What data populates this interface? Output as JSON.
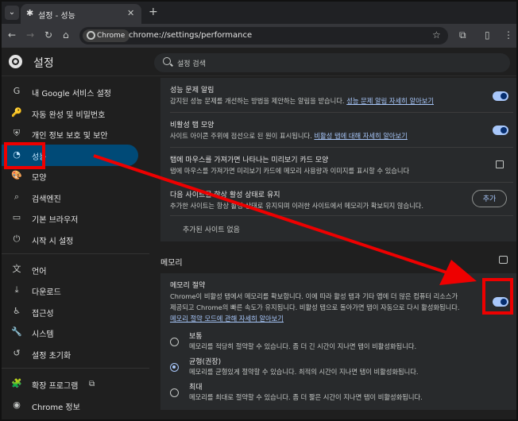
{
  "tabstrip": {
    "menu_icon": "chevron-down-icon",
    "tab_title": "설정 - 성능",
    "tab_icon": "gear-icon",
    "close_icon": "close-icon",
    "new_tab_icon": "plus-icon"
  },
  "navbar": {
    "chip_label": "Chrome",
    "url": "chrome://settings/performance",
    "star_icon": "star-icon"
  },
  "header": {
    "title": "설정",
    "search_placeholder": "설정 검색"
  },
  "sidebar": {
    "items": [
      {
        "icon": "G",
        "label": "내 Google 서비스 설정"
      },
      {
        "icon": "🔑",
        "label": "자동 완성 및 비밀번호"
      },
      {
        "icon": "⛨",
        "label": "개인 정보 보호 및 보안"
      },
      {
        "icon": "◔",
        "label": "성능"
      },
      {
        "icon": "🎨",
        "label": "모양"
      },
      {
        "icon": "⌕",
        "label": "검색엔진"
      },
      {
        "icon": "▭",
        "label": "기본 브라우저"
      },
      {
        "icon": "⏻",
        "label": "시작 시 설정"
      },
      {
        "icon": "文",
        "label": "언어"
      },
      {
        "icon": "⤓",
        "label": "다운로드"
      },
      {
        "icon": "♿",
        "label": "접근성"
      },
      {
        "icon": "🔧",
        "label": "시스템"
      },
      {
        "icon": "↺",
        "label": "설정 초기화"
      },
      {
        "icon": "🧩",
        "label": "확장 프로그램"
      },
      {
        "icon": "◉",
        "label": "Chrome 정보"
      }
    ],
    "active_index": 3,
    "external_link_icon": "external-link-icon"
  },
  "performance": {
    "rows": [
      {
        "title": "성능 문제 알림",
        "desc": "감지된 성능 문제를 개선하는 방법을 제안하는 알림을 받습니다.",
        "link": "성능 문제 알림 자세히 알아보기",
        "control": "toggle",
        "on": true
      },
      {
        "title": "비활성 탭 모양",
        "desc": "사이트 아이콘 주위에 점선으로 된 원이 표시됩니다.",
        "link": "비활성 탭에 대해 자세히 알아보기",
        "control": "toggle",
        "on": true
      },
      {
        "title": "탭에 마우스를 가져가면 나타나는 미리보기 카드 모양",
        "desc": "탭에 마우스를 가져가면 미리보기 카드에 메모리 사용량과 이미지를 표시할 수 있습니다",
        "link": "",
        "control": "open"
      },
      {
        "title": "다음 사이트를 항상 활성 상태로 유지",
        "desc": "추가한 사이트는 항상 활성 상태로 유지되며 이러한 사이트에서 메모리가 확보되지 않습니다.",
        "link": "",
        "control": "button",
        "button_label": "추가"
      }
    ],
    "empty_sites": "추가된 사이트 없음"
  },
  "memory": {
    "section_title": "메모리",
    "saver_title": "메모리 절약",
    "saver_desc_1": "Chrome이 비활성 탭에서 메모리를 확보합니다. 이에 따라 활성 탭과 기타 앱에 더 많은 컴퓨터 리소스가",
    "saver_desc_2": "제공되고 Chrome의 빠른 속도가 유지됩니다. 비활성 탭으로 돌아가면 탭이 자동으로 다시 활성화됩니다.",
    "saver_link": "메모리 절약 모드에 관해 자세히 알아보기",
    "saver_on": true,
    "options": [
      {
        "title": "보통",
        "desc": "메모리를 적당히 절약할 수 있습니다. 좀 더 긴 시간이 지나면 탭이 비활성화됩니다.",
        "checked": false
      },
      {
        "title": "균형(권장)",
        "desc": "메모리를 균형있게 절약할 수 있습니다. 최적의 시간이 지나면 탭이 비활성화됩니다.",
        "checked": true
      },
      {
        "title": "최대",
        "desc": "메모리를 최대로 절약할 수 있습니다. 좀 더 짧은 시간이 지나면 탭이 비활성화됩니다.",
        "checked": false
      }
    ]
  },
  "annotation": {
    "color": "#ee0000"
  }
}
